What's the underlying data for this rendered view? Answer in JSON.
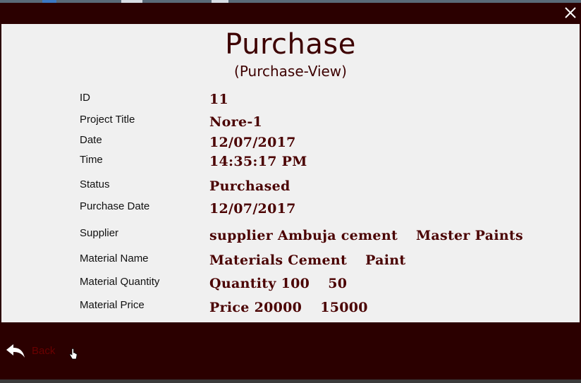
{
  "window": {
    "close_glyph": "✕"
  },
  "header": {
    "title": "Purchase",
    "subtitle": "(Purchase-View)"
  },
  "details": [
    {
      "label": "ID",
      "values": [
        "11"
      ]
    },
    {
      "label": "Project Title",
      "values": [
        "Nore-1"
      ]
    },
    {
      "label": "Date",
      "values": [
        "12/07/2017"
      ]
    },
    {
      "label": "Time",
      "values": [
        "14:35:17 PM"
      ]
    },
    {
      "label": "Status",
      "values": [
        "Purchased"
      ]
    },
    {
      "label": "Purchase Date",
      "values": [
        "12/07/2017"
      ]
    },
    {
      "label": "Supplier",
      "values": [
        "supplier Ambuja cement",
        "Master Paints"
      ]
    },
    {
      "label": "Material Name",
      "values": [
        "Materials Cement",
        "Paint"
      ]
    },
    {
      "label": "Material Quantity",
      "values": [
        "Quantity 100",
        "50"
      ]
    },
    {
      "label": "Material Price",
      "values": [
        "Price 20000",
        "15000"
      ]
    }
  ],
  "footer": {
    "back_label": "Back",
    "back_icon": "reply-arrow-icon"
  },
  "colors": {
    "frame": "#2b0000",
    "content_bg": "#f0f0f0",
    "title": "#3d0000",
    "value": "#4a0000",
    "back_label": "#6a0000"
  }
}
